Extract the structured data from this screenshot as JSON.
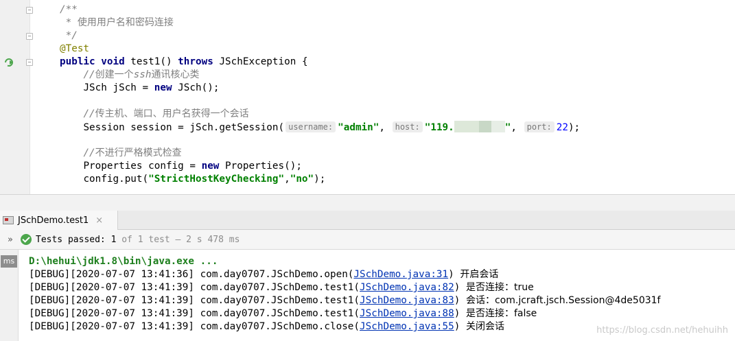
{
  "editor": {
    "lines": {
      "l1": "/**",
      "l2_star": " * ",
      "l2_text": "使用用户名和密码连接",
      "l3": " */",
      "l4": "@Test",
      "l5_kw1": "public void ",
      "l5_name": "test1() ",
      "l5_kw2": "throws ",
      "l5_rest": "JSchException {",
      "l6_slashes": "//",
      "l6_a": "创建一个",
      "l6_b": "ssh",
      "l6_c": "通讯核心类",
      "l7_a": "JSch jSch = ",
      "l7_kw": "new ",
      "l7_b": "JSch();",
      "l9_slashes": "//",
      "l9_text": "传主机、端口、用户名获得一个会话",
      "l10_a": "Session session = jSch.getSession(",
      "l10_s1": "\"admin\"",
      "l10_comma1": ", ",
      "l10_s2": "\"119.",
      "l10_s2_end": "\"",
      "l10_comma2": ", ",
      "l10_num": "22",
      "l10_end": ");",
      "l12_slashes": "//",
      "l12_text": "不进行严格模式检查",
      "l13_a": "Properties config = ",
      "l13_kw": "new ",
      "l13_b": "Properties();",
      "l14_a": "config.put(",
      "l14_s1": "\"StrictHostKeyChecking\"",
      "l14_comma": ",",
      "l14_s2": "\"no\"",
      "l14_end": ");"
    },
    "hints": {
      "username": "username:",
      "host": "host:",
      "port": "port:"
    }
  },
  "run_panel": {
    "tab_label": "JSchDemo.test1",
    "tab_close": "×",
    "expand_glyph": "»",
    "status_prefix": "Tests passed: ",
    "status_count": "1",
    "status_suffix": " of 1 test – 2 s 478 ms"
  },
  "console": {
    "gutter_badge": "ms",
    "path_line": "D:\\hehui\\jdk1.8\\bin\\java.exe ...",
    "logs": [
      {
        "prefix": "[DEBUG][2020-07-07 13:41:36] com.day0707.JSchDemo.open(",
        "link": "JSchDemo.java:31",
        "close": ") ",
        "message": "开启会话"
      },
      {
        "prefix": "[DEBUG][2020-07-07 13:41:39] com.day0707.JSchDemo.test1(",
        "link": "JSchDemo.java:82",
        "close": ") ",
        "message": "是否连接：true"
      },
      {
        "prefix": "[DEBUG][2020-07-07 13:41:39] com.day0707.JSchDemo.test1(",
        "link": "JSchDemo.java:83",
        "close": ") ",
        "message": "会话：com.jcraft.jsch.Session@4de5031f"
      },
      {
        "prefix": "[DEBUG][2020-07-07 13:41:39] com.day0707.JSchDemo.test1(",
        "link": "JSchDemo.java:88",
        "close": ") ",
        "message": "是否连接：false"
      },
      {
        "prefix": "[DEBUG][2020-07-07 13:41:39] com.day0707.JSchDemo.close(",
        "link": "JSchDemo.java:55",
        "close": ") ",
        "message": "关闭会话"
      }
    ],
    "watermark": "https://blog.csdn.net/hehuihh"
  },
  "colors": {
    "keyword": "#000080",
    "string": "#008000",
    "annotation": "#808000",
    "comment": "#808080",
    "number": "#0000ff",
    "link": "#0033b3",
    "path": "#1d7f1d",
    "pass": "#4ca64c"
  },
  "icons": {
    "gutter_run": "run-test-icon",
    "tab": "run-config-icon",
    "status": "test-passed-icon"
  }
}
